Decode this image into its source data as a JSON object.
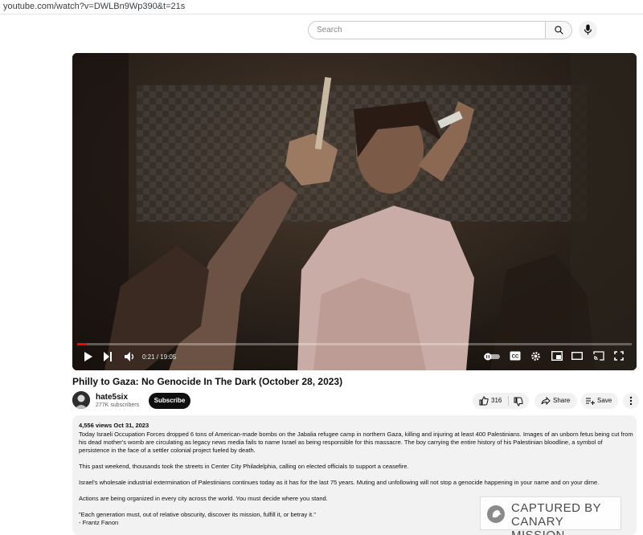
{
  "browser": {
    "url": "youtube.com/watch?v=DWLBn9Wp390&t=21s"
  },
  "header": {
    "search_placeholder": "Search",
    "search_icon": "search-icon",
    "mic_icon": "microphone-icon"
  },
  "player": {
    "time": "0:21 / 19:05",
    "progress_fraction": 0.018,
    "controls": [
      "play-icon",
      "next-icon",
      "volume-icon",
      "autoplay-toggle",
      "captions-icon",
      "settings-icon",
      "miniplayer-icon",
      "theater-icon",
      "cast-icon",
      "fullscreen-icon"
    ]
  },
  "video": {
    "title": "Philly to Gaza: No Genocide In The Dark (October 28, 2023)"
  },
  "channel": {
    "name": "hate5six",
    "subscribers": "277K subscribers",
    "subscribe_label": "Subscribe"
  },
  "actions": {
    "likes": "316",
    "share_label": "Share",
    "save_label": "Save"
  },
  "description": {
    "meta": "4,556 views  Oct 31, 2023",
    "paragraphs": [
      "Today Israeli Occupation Forces dropped 6 tons of American-made bombs on the Jabalia refugee camp in northern Gaza, killing and injuring at least 400 Palestinians. Images of an unborn fetus being cut from his dead mother's womb are circulating as legacy news media fails to name Israel as being responsible for this massacre. The boy carrying the entire history of his Palestinian bloodline, a symbol of persistence in the face of a settler colonial project fueled by death.",
      "This past weekend, thousands took the streets in Center City Philadelphia, calling on elected officials to support a ceasefire.",
      "Israel's wholesale industrial extermination of Palestinians continues today as it has for the last 75 years. Muting and unfollowing will not stop a genocide happening in your name and on your dime.",
      "Actions are being organized in every city across the world. You must decide where you stand."
    ],
    "quote": "\"Each generation must, out of relative obscurity, discover its mission, fulfill it, or betray it.\"",
    "quote_author": "- Frantz Fanon"
  },
  "watermark": {
    "line1": "CAPTURED BY",
    "line2": "CANARY MISSION"
  }
}
